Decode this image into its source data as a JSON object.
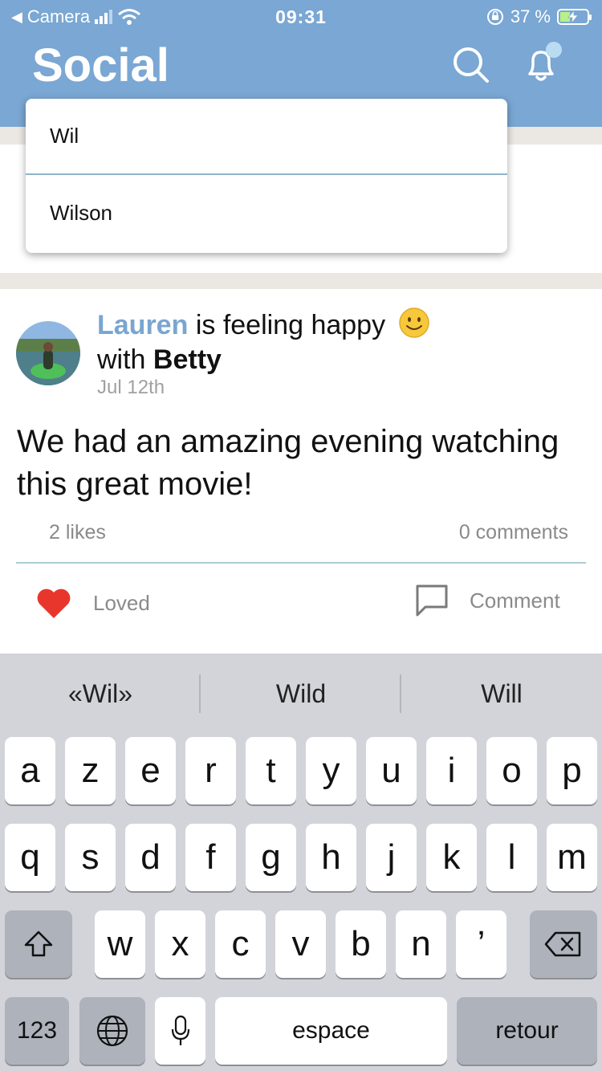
{
  "status_bar": {
    "back_label": "Camera",
    "time": "09:31",
    "battery_percent": "37 %",
    "battery_level": 0.37
  },
  "header": {
    "title": "Social"
  },
  "suggestions": {
    "items": [
      "Wil",
      "Wilson"
    ]
  },
  "post": {
    "author": "Lauren",
    "feeling_text": "is feeling happy",
    "with_text": "with",
    "tagged": "Betty",
    "date": "Jul 12th",
    "body": "We had an amazing evening watching this great movie!",
    "likes": "2 likes",
    "comments": "0 comments",
    "loved_label": "Loved",
    "comment_label": "Comment"
  },
  "keyboard": {
    "predictions": [
      "«Wil»",
      "Wild",
      "Will"
    ],
    "row1": [
      "a",
      "z",
      "e",
      "r",
      "t",
      "y",
      "u",
      "i",
      "o",
      "p"
    ],
    "row2": [
      "q",
      "s",
      "d",
      "f",
      "g",
      "h",
      "j",
      "k",
      "l",
      "m"
    ],
    "row3": [
      "w",
      "x",
      "c",
      "v",
      "b",
      "n",
      "’"
    ],
    "numbers_label": "123",
    "space_label": "espace",
    "return_label": "retour"
  },
  "colors": {
    "header": "#7aa7d3",
    "author": "#79a6d0",
    "heart": "#e8362c",
    "keyboard_bg": "#d2d4da"
  }
}
